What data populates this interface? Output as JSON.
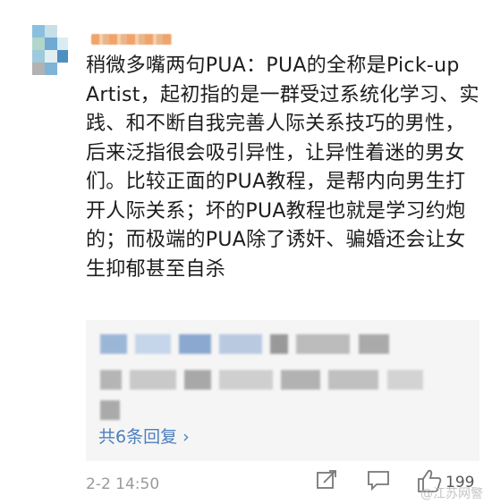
{
  "comment": {
    "text": "稍微多嘴两句PUA：PUA的全称是Pick-up Artist，起初指的是一群受过系统化学习、实践、和不断自我完善人际关系技巧的男性，后来泛指很会吸引异性，让异性着迷的男女们。比较正面的PUA教程，是帮内向男生打开人际关系；坏的PUA教程也就是学习约炮的；而极端的PUA除了诱奸、骗婚还会让女生抑郁甚至自杀",
    "timestamp": "2-2 14:50",
    "like_count": "199"
  },
  "replies": {
    "count_label": "共6条回复 ›"
  },
  "watermark": "@江苏网警",
  "icons": [
    "avatar",
    "share-icon",
    "comment-icon",
    "like-icon"
  ],
  "colors": {
    "link": "#4d7fbd",
    "meta": "#9a9a9a",
    "reply_bg": "#f5f5f5"
  }
}
